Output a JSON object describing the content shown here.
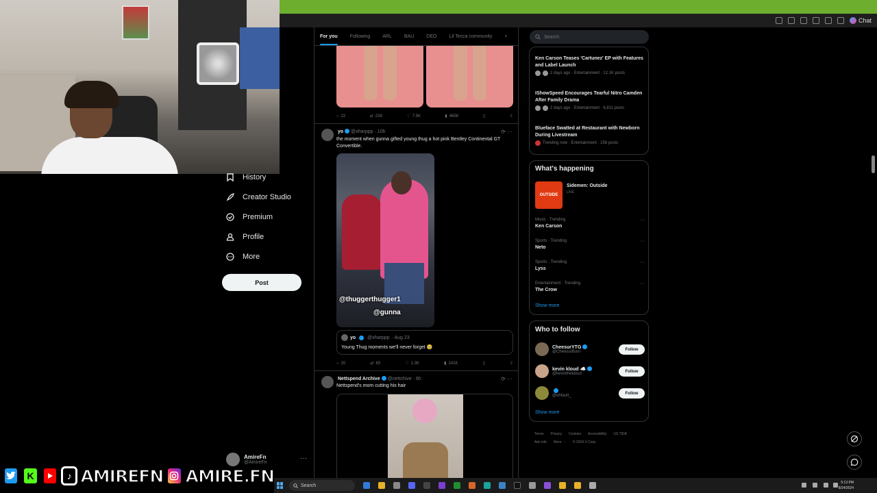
{
  "browser": {
    "chat_label": "Chat"
  },
  "nav": {
    "items": [
      {
        "label": "History",
        "icon": "bookmark-icon"
      },
      {
        "label": "Creator Studio",
        "icon": "rocket-icon"
      },
      {
        "label": "Premium",
        "icon": "verified-badge-icon"
      },
      {
        "label": "Profile",
        "icon": "person-icon"
      },
      {
        "label": "More",
        "icon": "more-circle-icon"
      }
    ],
    "post_label": "Post",
    "account": {
      "name": "AmireFn",
      "handle": "@AmireFn",
      "menu": "···"
    }
  },
  "banner": {
    "text1": "AMIREFN",
    "text2": "AMIRE.FN"
  },
  "tabs": [
    "For you",
    "Following",
    "ARL",
    "BAU",
    "DEO",
    "Lil Tecca community",
    "+"
  ],
  "tweets": {
    "t0": {
      "replies": "22",
      "reposts": "239",
      "likes": "7.5K",
      "views": "465K"
    },
    "t1": {
      "name": "yo",
      "handle": "@xharppp",
      "time": "· 10h",
      "text": "the moment when gunna gifted young thug a hot pink Bentley Continental GT Convertible.",
      "caption1": "@thuggerthugger1",
      "caption2": "@gunna",
      "quote": {
        "name": "yo",
        "handle": "@xharppp",
        "time": "· Aug 23",
        "text": "Young Thug moments we'll never forget 🥹"
      },
      "replies": "20",
      "reposts": "83",
      "likes": "1.3K",
      "views": "141K"
    },
    "t2": {
      "name": "Nettspend Archive",
      "handle": "@nettchive",
      "time": "· 6h",
      "text": "Nettspend's mom cutting his hair"
    }
  },
  "sidebar": {
    "search_placeholder": "Search",
    "news": [
      {
        "title": "Ken Carson Teases 'Cartunez' EP with Features and Label Launch",
        "meta": "2 days ago · Entertainment · 12.1K posts"
      },
      {
        "title": "IShowSpeed Encourages Tearful Nitro Camden After Family Drama",
        "meta": "2 days ago · Entertainment · 6,811 posts"
      },
      {
        "title": "Blueface Swatted at Restaurant with Newborn During Livestream",
        "meta": "Trending now · Entertainment · 158 posts"
      }
    ],
    "happening": {
      "title": "What's happening",
      "live": {
        "name": "Sidemen: Outside",
        "status": "LIVE"
      },
      "trends": [
        {
          "context": "Music · Trending",
          "name": "Ken Carson"
        },
        {
          "context": "Sports · Trending",
          "name": "Neto"
        },
        {
          "context": "Sports · Trending",
          "name": "Lyss"
        },
        {
          "context": "Entertainment · Trending",
          "name": "The Crow"
        }
      ],
      "show_more": "Show more"
    },
    "who_to_follow": {
      "title": "Who to follow",
      "accounts": [
        {
          "name": "CheesurYTG",
          "handle": "@CheesurBurn"
        },
        {
          "name": "kevin kloud ☁️",
          "handle": "@kevinthekloud"
        },
        {
          "name": "",
          "handle": "@ohfault_"
        }
      ],
      "follow_label": "Follow",
      "show_more": "Show more"
    },
    "footer": [
      "Terms",
      "Privacy",
      "Cookies",
      "Accessibility",
      "US TIDA",
      "Ads info",
      "More ···",
      "© 2024 X Corp."
    ]
  },
  "taskbar": {
    "search": "Search",
    "time": "5:13 PM",
    "date": "8/24/2024"
  },
  "colors": {
    "accent": "#1d9bf0",
    "browser_bar": "#6dae2f",
    "bg": "#000000"
  }
}
